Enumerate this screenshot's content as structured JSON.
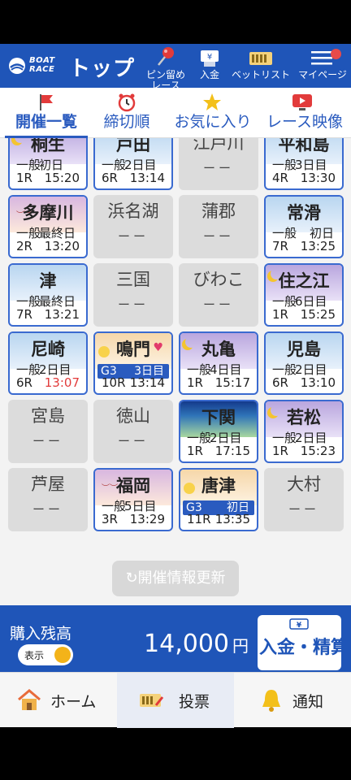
{
  "header": {
    "logo_text": "BOAT\nRACE",
    "title": "トップ",
    "nav": [
      {
        "label": "ピン留め\nレース",
        "icon": "pin-icon"
      },
      {
        "label": "入金",
        "icon": "deposit-icon"
      },
      {
        "label": "ベットリスト",
        "icon": "betlist-icon"
      },
      {
        "label": "マイページ",
        "icon": "menu-icon"
      }
    ]
  },
  "tabs": [
    {
      "label": "開催一覧",
      "icon": "flag-icon",
      "active": true
    },
    {
      "label": "締切順",
      "icon": "clock-icon",
      "active": false
    },
    {
      "label": "お気に入り",
      "icon": "star-icon",
      "active": false
    },
    {
      "label": "レース映像",
      "icon": "video-icon",
      "active": false
    }
  ],
  "venues": [
    {
      "name": "桐生",
      "status": "active",
      "sky": "sky-purple",
      "grade": "一般",
      "day": "初日",
      "race": "1R",
      "time": "15:20",
      "deco": "moon"
    },
    {
      "name": "戸田",
      "status": "active",
      "sky": "sky-blue",
      "grade": "一般",
      "day": "2日目",
      "race": "6R",
      "time": "13:14"
    },
    {
      "name": "江戸川",
      "status": "inactive",
      "dash": "ーー"
    },
    {
      "name": "平和島",
      "status": "active",
      "sky": "sky-blue",
      "grade": "一般",
      "day": "3日目",
      "race": "4R",
      "time": "13:30"
    },
    {
      "name": "多摩川",
      "status": "active",
      "sky": "sky-pink",
      "grade": "一般",
      "day": "最終日",
      "race": "2R",
      "time": "13:20",
      "deco": "birds"
    },
    {
      "name": "浜名湖",
      "status": "inactive",
      "dash": "ーー"
    },
    {
      "name": "蒲郡",
      "status": "inactive",
      "dash": "ーー"
    },
    {
      "name": "常滑",
      "status": "active",
      "sky": "sky-blue",
      "grade": "一般",
      "day": "初日",
      "race": "7R",
      "time": "13:25",
      "inline": true
    },
    {
      "name": "津",
      "status": "active",
      "sky": "sky-blue",
      "grade": "一般",
      "day": "最終日",
      "race": "7R",
      "time": "13:21"
    },
    {
      "name": "三国",
      "status": "inactive",
      "dash": "ーー"
    },
    {
      "name": "びわこ",
      "status": "inactive",
      "dash": "ーー"
    },
    {
      "name": "住之江",
      "status": "active",
      "sky": "sky-purple",
      "grade": "一般",
      "day": "6日目",
      "race": "1R",
      "time": "15:25",
      "deco": "moon"
    },
    {
      "name": "尼崎",
      "status": "active",
      "sky": "sky-blue",
      "grade": "一般",
      "day": "2日目",
      "race": "6R",
      "time": "13:07",
      "time_red": true
    },
    {
      "name": "鳴門",
      "status": "active",
      "sky": "sky-peach",
      "gbar": "G3",
      "day": "3日目",
      "race": "10R",
      "time": "13:14",
      "deco": "sun",
      "heart": true
    },
    {
      "name": "丸亀",
      "status": "active",
      "sky": "sky-purple",
      "grade": "一般",
      "day": "4日目",
      "race": "1R",
      "time": "15:17",
      "deco": "moon"
    },
    {
      "name": "児島",
      "status": "active",
      "sky": "sky-blue",
      "grade": "一般",
      "day": "2日目",
      "race": "6R",
      "time": "13:10"
    },
    {
      "name": "宮島",
      "status": "inactive",
      "dash": "ーー"
    },
    {
      "name": "徳山",
      "status": "inactive",
      "dash": "ーー"
    },
    {
      "name": "下関",
      "status": "active",
      "sky": "sky-green",
      "grade": "一般",
      "day": "2日目",
      "race": "1R",
      "time": "17:15"
    },
    {
      "name": "若松",
      "status": "active",
      "sky": "sky-purple",
      "grade": "一般",
      "day": "2日目",
      "race": "1R",
      "time": "15:23",
      "deco": "moon"
    },
    {
      "name": "芦屋",
      "status": "inactive",
      "dash": "ーー"
    },
    {
      "name": "福岡",
      "status": "active",
      "sky": "sky-pink",
      "grade": "一般",
      "day": "5日目",
      "race": "3R",
      "time": "13:29",
      "deco": "birds"
    },
    {
      "name": "唐津",
      "status": "active",
      "sky": "sky-peach",
      "gbar": "G3",
      "day": "初日",
      "race": "11R",
      "time": "13:35",
      "deco": "sun"
    },
    {
      "name": "大村",
      "status": "inactive",
      "dash": "ーー"
    }
  ],
  "refresh_label": "開催情報更新",
  "balance": {
    "title": "購入残高",
    "toggle_label": "表示",
    "amount": "14,000",
    "currency": "円",
    "deposit_label": "入金・精算"
  },
  "bottom_nav": [
    {
      "label": "ホーム",
      "icon": "home-icon"
    },
    {
      "label": "投票",
      "icon": "ticket-icon"
    },
    {
      "label": "通知",
      "icon": "bell-icon"
    }
  ],
  "colors": {
    "brand": "#1f55b8",
    "accent": "#2a5bbf",
    "alert": "#e23b3b",
    "toggle_knob": "#f3b319"
  }
}
